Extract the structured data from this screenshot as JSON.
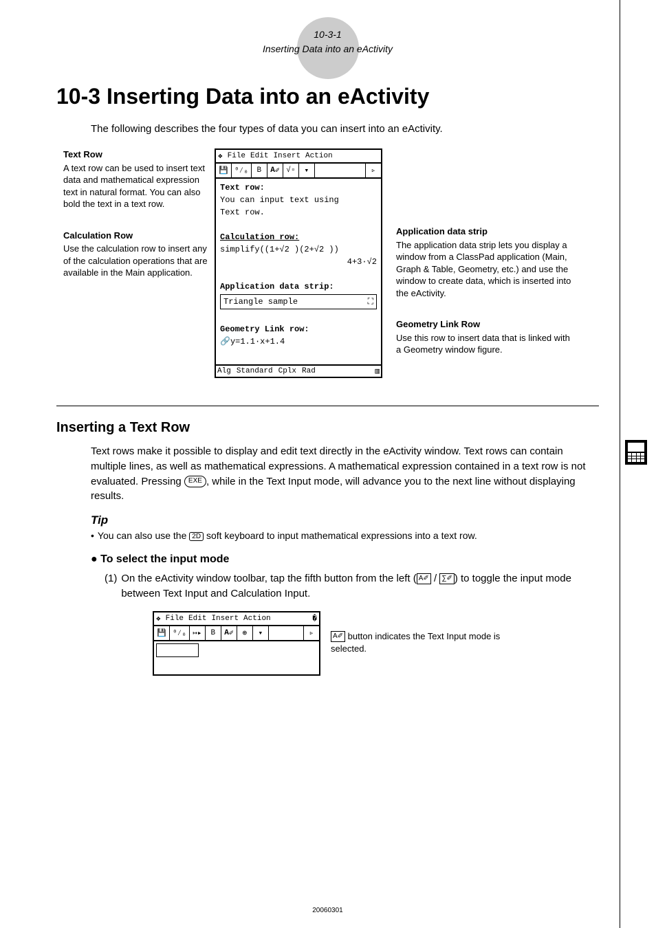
{
  "header": {
    "page_num": "10-3-1",
    "page_title": "Inserting Data into an eActivity"
  },
  "title": "10-3 Inserting Data into an eActivity",
  "intro": "The following describes the four types of data you can insert into an eActivity.",
  "labels": {
    "text_row_title": "Text Row",
    "text_row_desc": "A text row can be used to insert text data and mathematical expression text in natural format. You can also bold the text in a text row.",
    "calc_row_title": "Calculation Row",
    "calc_row_desc": "Use the calculation row to insert any of the calculation operations that are available in the Main application.",
    "app_strip_title": "Application data strip",
    "app_strip_desc": "The application data strip lets you display a window from a ClassPad application (Main, Graph & Table, Geometry, etc.) and use the window to create data, which is inserted into the eActivity.",
    "geom_title": "Geometry Link Row",
    "geom_desc": "Use this row to insert data that is linked with a Geometry window figure."
  },
  "screen": {
    "menus": [
      "File",
      "Edit",
      "Insert",
      "Action"
    ],
    "section1": "Text row:",
    "line1a": "You can input text using",
    "line1b": "Text row.",
    "section2": "Calculation row:",
    "line2a": "simplify((1+√2 )(2+√2 ))",
    "line2b": "4+3·√2",
    "section3": "Application data strip:",
    "strip_label": "Triangle sample",
    "section4": "Geometry Link row:",
    "line4a": "y=1.1·x+1.4",
    "status": [
      "Alg",
      "Standard",
      "Cplx",
      "Rad"
    ]
  },
  "h2": "Inserting a Text Row",
  "para1_a": "Text rows make it possible to display and edit text directly in the eActivity window. Text rows can contain multiple lines, as well as mathematical expressions. A mathematical expression contained in a text row is not evaluated.  Pressing ",
  "para1_b": ", while in the Text Input mode, will advance you to the next line without displaying results.",
  "tip_title": "Tip",
  "tip_bullet_a": "You can also use the ",
  "tip_bullet_b": " soft keyboard to input mathematical expressions into a text row.",
  "procedure_title": "To select the input mode",
  "step1_a": "On the eActivity window toolbar, tap the fifth button from the left (",
  "step1_b": " / ",
  "step1_c": ") to toggle the input mode between Text Input and Calculation Input.",
  "caption_a": " button indicates the Text Input mode is selected.",
  "keys": {
    "exe": "EXE",
    "twoD": "2D",
    "A": "A✐",
    "calc": "∑✐"
  },
  "footer": "20060301"
}
